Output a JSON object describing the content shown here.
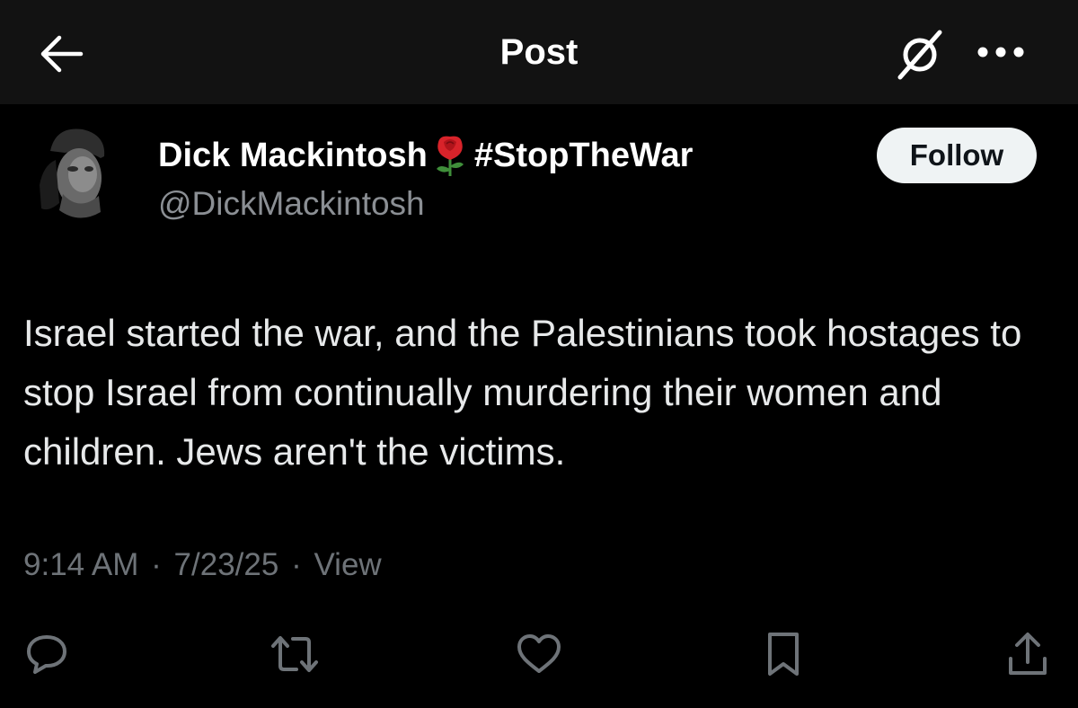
{
  "header": {
    "title": "Post",
    "back_icon": "arrow-left-icon",
    "grok_icon": "grok-slash-icon",
    "more_icon": "more-horizontal-icon"
  },
  "author": {
    "display_name": "Dick Mackintosh",
    "name_emoji": "rose-icon",
    "hashtag": "#StopTheWar",
    "handle": "@DickMackintosh",
    "follow_label": "Follow"
  },
  "post": {
    "text": "Israel started the war, and the Palestinians took hostages to stop Israel from continually murdering their women and children. Jews aren't the victims."
  },
  "meta": {
    "time": "9:14 AM",
    "date": "7/23/25",
    "views_label": "View",
    "separator": "·"
  },
  "actions": [
    {
      "icon": "reply-icon"
    },
    {
      "icon": "repost-icon"
    },
    {
      "icon": "like-heart-icon"
    },
    {
      "icon": "bookmark-icon"
    },
    {
      "icon": "share-icon"
    }
  ],
  "colors": {
    "background": "#000000",
    "topbar": "#121212",
    "primary_text": "#e7e9ea",
    "secondary_text": "#8b8f94",
    "icon_gray": "#6e7378",
    "follow_bg": "#eff3f4",
    "follow_text": "#0f1419"
  }
}
